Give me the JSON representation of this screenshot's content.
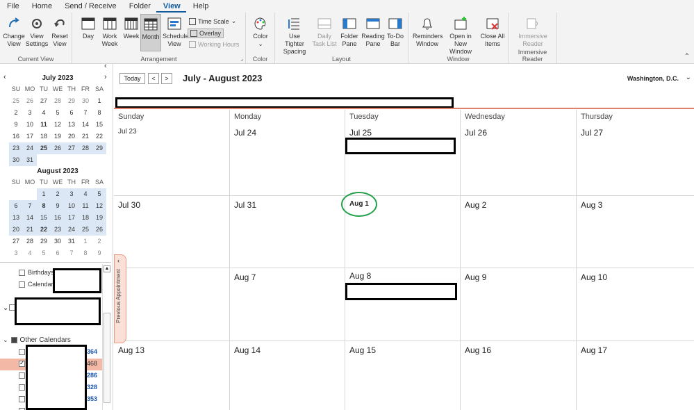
{
  "menu": {
    "tabs": [
      "File",
      "Home",
      "Send / Receive",
      "Folder",
      "View",
      "Help"
    ],
    "active": "View"
  },
  "ribbon": {
    "current_view": {
      "label": "Current View",
      "buttons": [
        "Change View",
        "View Settings",
        "Reset View"
      ]
    },
    "arrangement": {
      "label": "Arrangement",
      "buttons": [
        "Day",
        "Work Week",
        "Week",
        "Month",
        "Schedule View"
      ],
      "selected": "Month",
      "time_scale": "Time Scale",
      "overlay": "Overlay",
      "working_hours": "Working Hours"
    },
    "color": {
      "label": "Color",
      "button": "Color"
    },
    "layout": {
      "label": "Layout",
      "buttons": [
        "Use Tighter Spacing",
        "Daily Task List",
        "Folder Pane",
        "Reading Pane",
        "To-Do Bar"
      ]
    },
    "window": {
      "label": "Window",
      "buttons": [
        "Reminders Window",
        "Open in New Window",
        "Close All Items"
      ]
    },
    "immersive": {
      "label": "Immersive Reader",
      "button": "Immersive Reader"
    }
  },
  "mini_calendars": [
    {
      "title": "July 2023",
      "weekdays": [
        "SU",
        "MO",
        "TU",
        "WE",
        "TH",
        "FR",
        "SA"
      ],
      "weeks": [
        [
          "25",
          "26",
          "27",
          "28",
          "29",
          "30",
          "1"
        ],
        [
          "2",
          "3",
          "4",
          "5",
          "6",
          "7",
          "8"
        ],
        [
          "9",
          "10",
          "11",
          "12",
          "13",
          "14",
          "15"
        ],
        [
          "16",
          "17",
          "18",
          "19",
          "20",
          "21",
          "22"
        ],
        [
          "23",
          "24",
          "25",
          "26",
          "27",
          "28",
          "29"
        ],
        [
          "30",
          "31",
          "",
          "",
          "",
          "",
          ""
        ]
      ]
    },
    {
      "title": "August 2023",
      "weekdays": [
        "SU",
        "MO",
        "TU",
        "WE",
        "TH",
        "FR",
        "SA"
      ],
      "weeks": [
        [
          "",
          "",
          "1",
          "2",
          "3",
          "4",
          "5"
        ],
        [
          "6",
          "7",
          "8",
          "9",
          "10",
          "11",
          "12"
        ],
        [
          "13",
          "14",
          "15",
          "16",
          "17",
          "18",
          "19"
        ],
        [
          "20",
          "21",
          "22",
          "23",
          "24",
          "25",
          "26"
        ],
        [
          "27",
          "28",
          "29",
          "30",
          "31",
          "1",
          "2"
        ],
        [
          "3",
          "4",
          "5",
          "6",
          "7",
          "8",
          "9"
        ]
      ]
    }
  ],
  "folders": {
    "items": [
      "Birthdays",
      "Calendar"
    ],
    "other_calendars": "Other Calendars",
    "numbers": [
      "364",
      "468",
      "286",
      "328",
      "353"
    ]
  },
  "calendar": {
    "today_button": "Today",
    "prev": "<",
    "next": ">",
    "range_title": "July - August 2023",
    "location": "Washington, D.C.",
    "previous_appointment": "Previous Appointment",
    "day_headers": [
      "Sunday",
      "Monday",
      "Tuesday",
      "Wednesday",
      "Thursday"
    ],
    "weeks": [
      [
        "Jul 23",
        "Jul 24",
        "Jul 25",
        "Jul 26",
        "Jul 27"
      ],
      [
        "Jul 30",
        "Jul 31",
        "Aug 1",
        "Aug 2",
        "Aug 3"
      ],
      [
        "",
        "Aug 7",
        "Aug 8",
        "Aug 9",
        "Aug 10"
      ],
      [
        "Aug 13",
        "Aug 14",
        "Aug 15",
        "Aug 16",
        "Aug 17"
      ]
    ]
  }
}
